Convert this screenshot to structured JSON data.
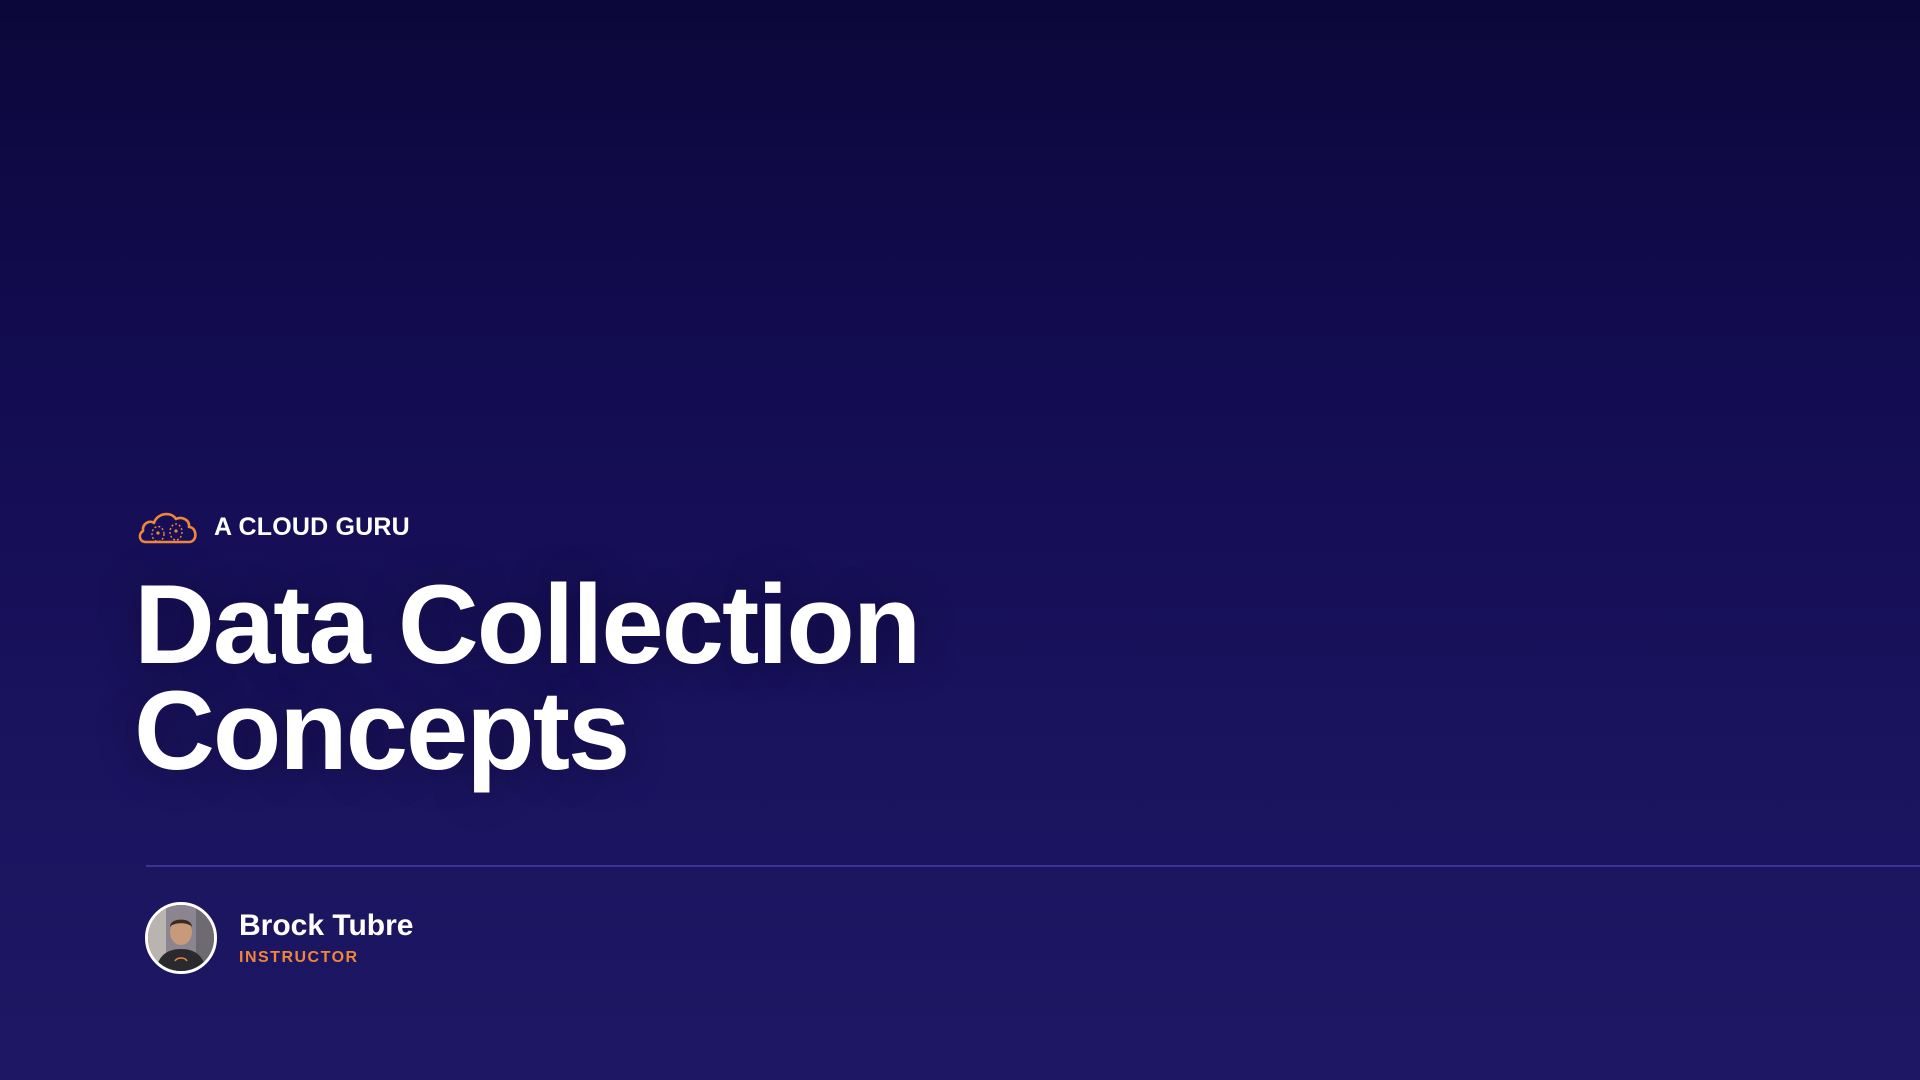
{
  "brand": {
    "name": "A CLOUD GURU",
    "icon": "cloud-guru-logo-icon",
    "accent_color": "#f0863a"
  },
  "title": {
    "line1": "Data Collection",
    "line2": "Concepts"
  },
  "presenter": {
    "name": "Brock Tubre",
    "role": "INSTRUCTOR",
    "avatar_icon": "instructor-avatar"
  },
  "colors": {
    "background_top": "#0c073a",
    "background_bottom": "#1e1864",
    "divider": "#3a3590",
    "text": "#ffffff",
    "accent": "#f0863a"
  }
}
